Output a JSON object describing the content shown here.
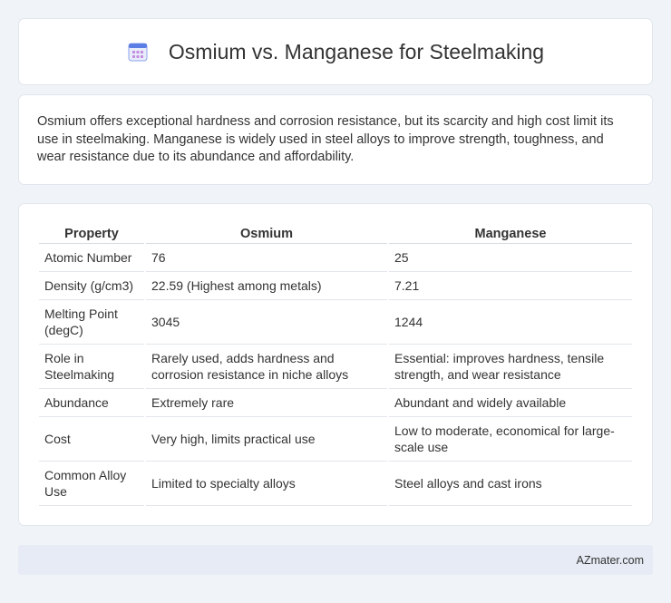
{
  "header": {
    "title": "Osmium vs. Manganese for Steelmaking",
    "icon": "calendar-icon"
  },
  "intro": {
    "text": "Osmium offers exceptional hardness and corrosion resistance, but its scarcity and high cost limit its use in steelmaking. Manganese is widely used in steel alloys to improve strength, toughness, and wear resistance due to its abundance and affordability."
  },
  "table": {
    "headers": [
      "Property",
      "Osmium",
      "Manganese"
    ],
    "rows": [
      [
        "Atomic Number",
        "76",
        "25"
      ],
      [
        "Density (g/cm3)",
        "22.59 (Highest among metals)",
        "7.21"
      ],
      [
        "Melting Point (degC)",
        "3045",
        "1244"
      ],
      [
        "Role in Steelmaking",
        "Rarely used, adds hardness and corrosion resistance in niche alloys",
        "Essential: improves hardness, tensile strength, and wear resistance"
      ],
      [
        "Abundance",
        "Extremely rare",
        "Abundant and widely available"
      ],
      [
        "Cost",
        "Very high, limits practical use",
        "Low to moderate, economical for large-scale use"
      ],
      [
        "Common Alloy Use",
        "Limited to specialty alloys",
        "Steel alloys and cast irons"
      ]
    ]
  },
  "footer": {
    "brand": "AZmater.com"
  },
  "colors": {
    "background": "#f0f3f8",
    "card": "#ffffff",
    "footer": "#e6ebf5",
    "icon_accent": "#5b7ee5"
  }
}
